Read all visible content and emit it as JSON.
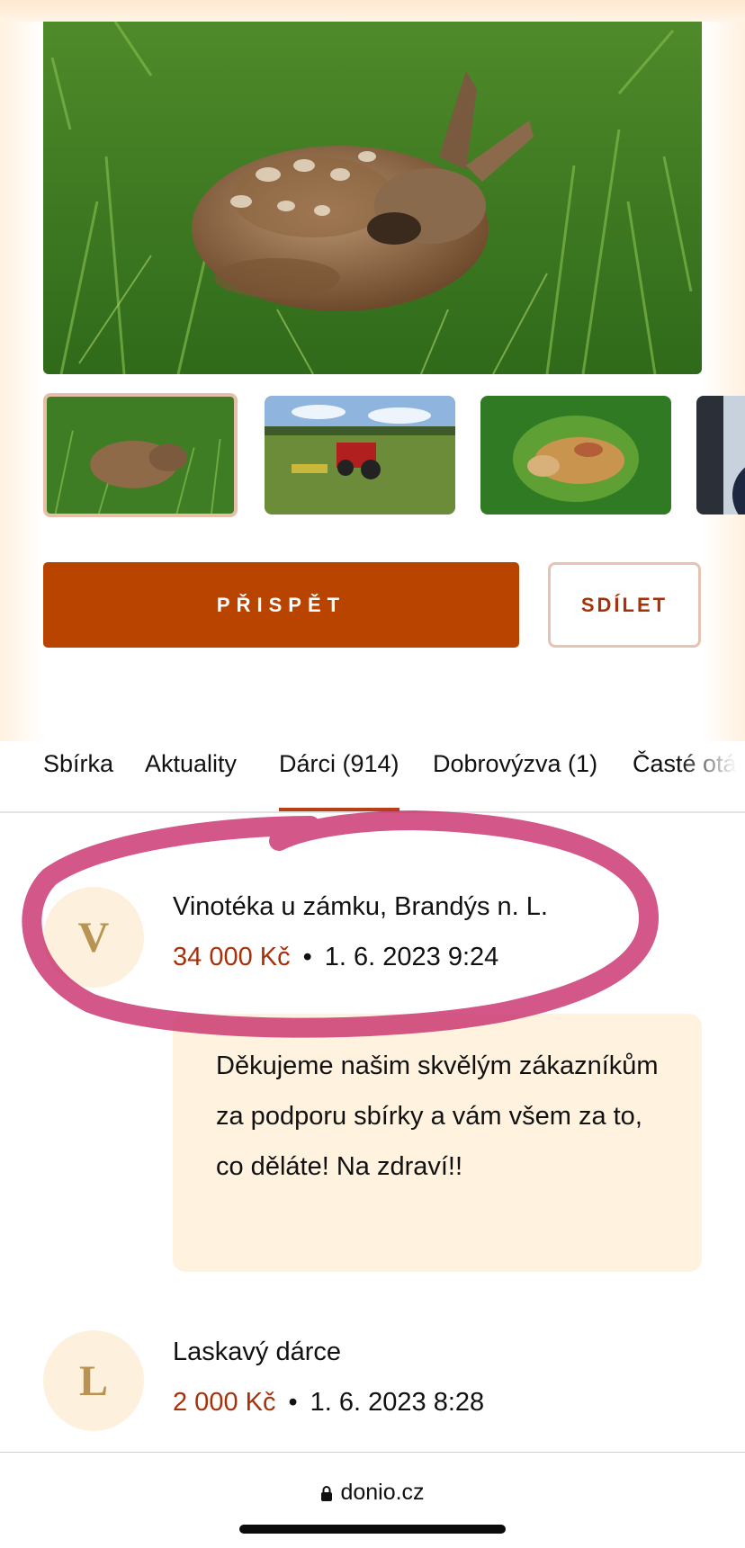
{
  "actions": {
    "contribute_label": "PŘISPĚT",
    "share_label": "SDÍLET"
  },
  "tabs": [
    {
      "label": "Sbírka",
      "active": false
    },
    {
      "label": "Aktuality",
      "active": false
    },
    {
      "label": "Dárci (914)",
      "active": true
    },
    {
      "label": "Dobrovýzva (1)",
      "active": false
    },
    {
      "label": "Časté otá",
      "active": false
    }
  ],
  "donors": [
    {
      "initial": "V",
      "name": "Vinotéka u zámku, Brandýs n. L.",
      "amount": "34 000 Kč",
      "separator": "•",
      "date": "1. 6. 2023 9:24",
      "message": "Děkujeme našim skvělým zákazníkům za podporu sbírky a vám všem za to, co děláte! Na zdraví!!"
    },
    {
      "initial": "L",
      "name": "Laskavý dárce",
      "amount": "2 000 Kč",
      "separator": "•",
      "date": "1. 6. 2023 8:28"
    }
  ],
  "browser": {
    "url": "donio.cz",
    "lock_icon": "lock-icon"
  },
  "colors": {
    "primary": "#b94400",
    "accent_text": "#a6320b",
    "avatar_bg": "#fdf1dd",
    "message_bg": "#fff3e0",
    "highlight": "#c2185b"
  }
}
